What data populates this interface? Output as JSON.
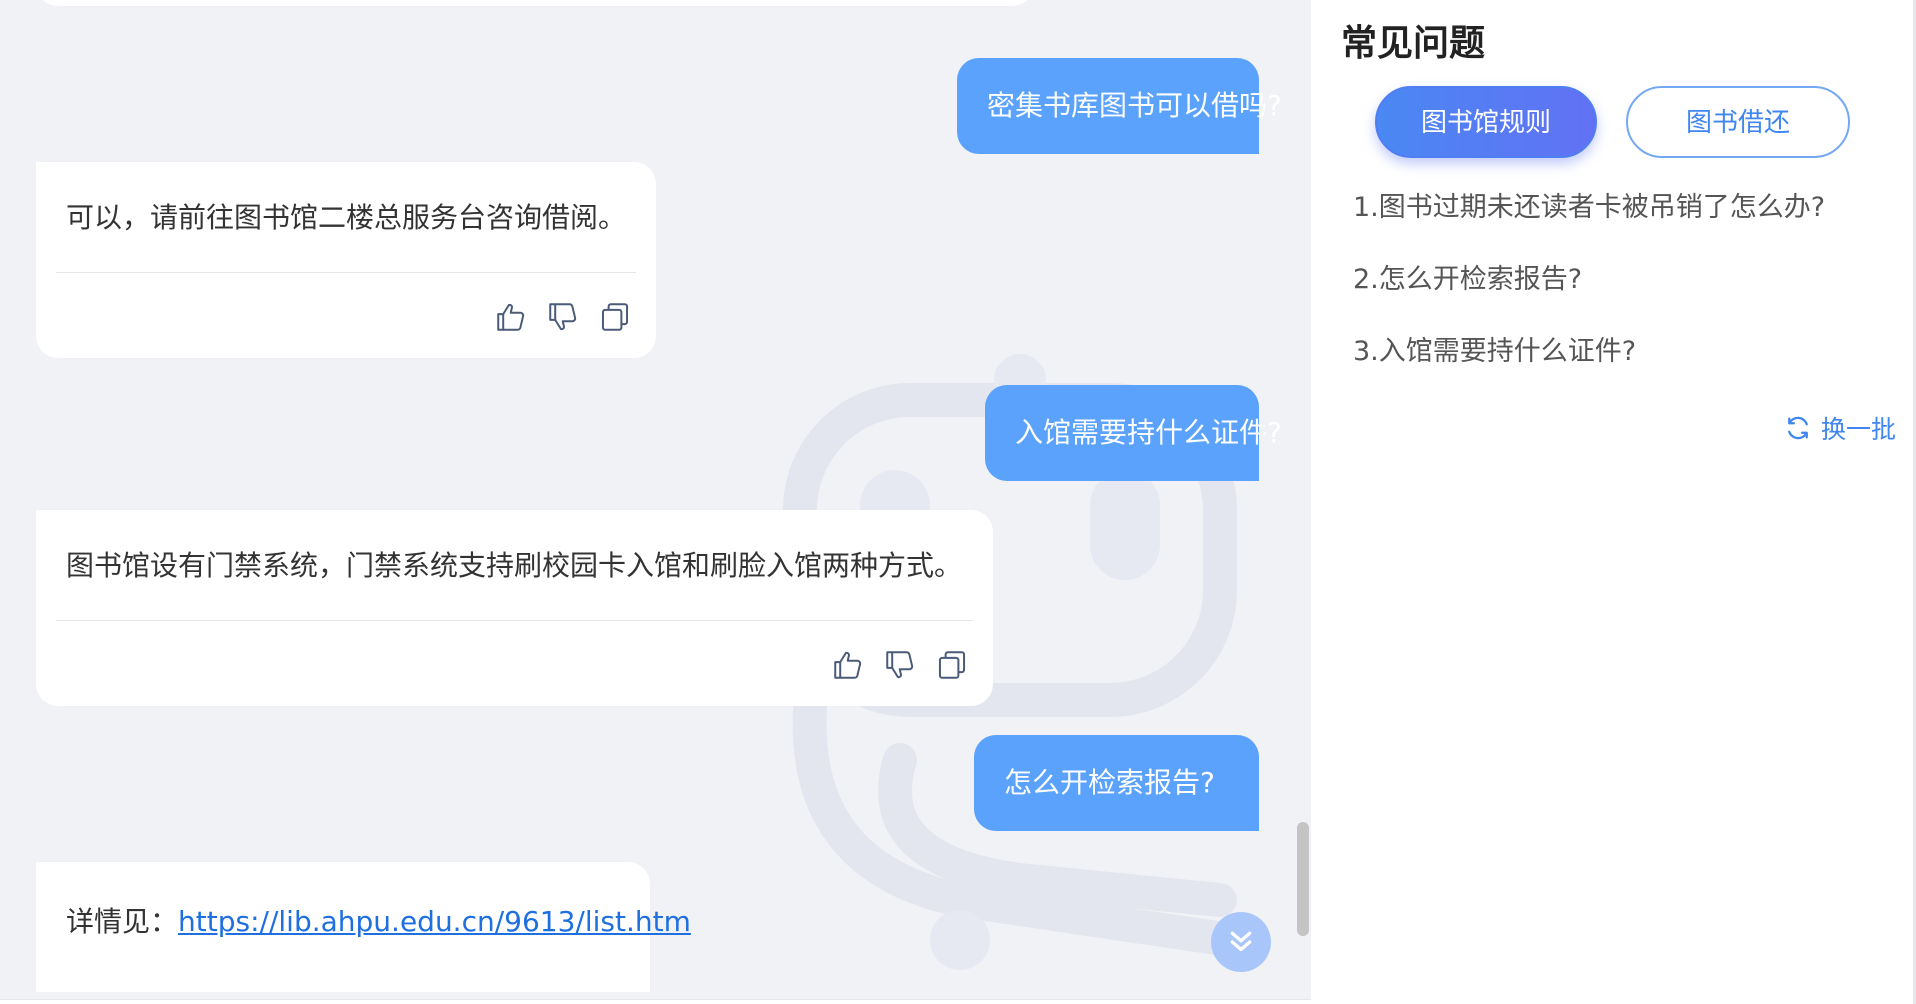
{
  "chat": {
    "messages": [
      {
        "role": "user",
        "text": "密集书库图书可以借吗?"
      },
      {
        "role": "bot",
        "text": "可以，请前往图书馆二楼总服务台咨询借阅。"
      },
      {
        "role": "user",
        "text": "入馆需要持什么证件?"
      },
      {
        "role": "bot",
        "text": "图书馆设有门禁系统，门禁系统支持刷校园卡入馆和刷脸入馆两种方式。"
      },
      {
        "role": "user",
        "text": "怎么开检索报告?"
      },
      {
        "role": "bot",
        "prefix": "详情见：",
        "link": "https://lib.ahpu.edu.cn/9613/list.htm"
      }
    ],
    "action_icons": [
      "thumbs-up-icon",
      "thumbs-down-icon",
      "copy-icon"
    ]
  },
  "faq": {
    "title": "常见问题",
    "tabs": [
      {
        "label": "图书馆规则",
        "active": true
      },
      {
        "label": "图书借还",
        "active": false
      }
    ],
    "questions": [
      "1.图书过期未还读者卡被吊销了怎么办?",
      "2.怎么开检索报告?",
      "3.入馆需要持什么证件?"
    ],
    "refresh_label": "换一批"
  },
  "colors": {
    "user_bubble": "#5aa2fb",
    "chat_bg": "#f1f2f6",
    "accent": "#3f86f0",
    "link": "#1e6fe0"
  }
}
